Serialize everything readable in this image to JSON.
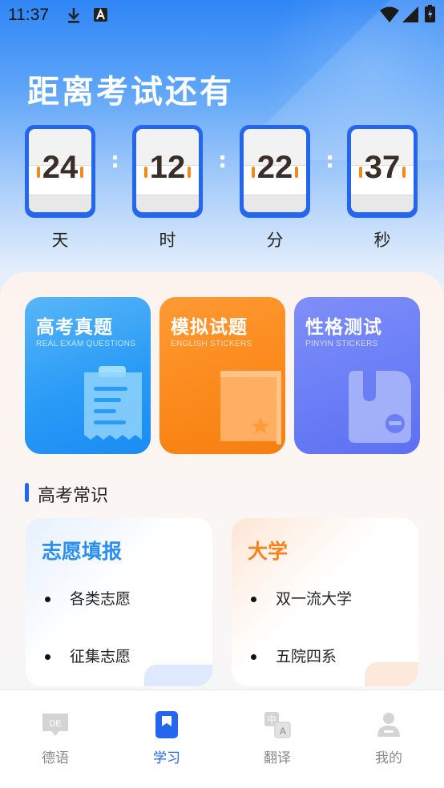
{
  "status_bar": {
    "time": "11:37",
    "icons": [
      "download-icon",
      "a-letter-icon",
      "wifi-icon",
      "signal-icon",
      "battery-icon"
    ]
  },
  "countdown": {
    "title": "距离考试还有",
    "units": [
      {
        "value": "24",
        "label": "天"
      },
      {
        "value": "12",
        "label": "时"
      },
      {
        "value": "22",
        "label": "分"
      },
      {
        "value": "37",
        "label": "秒"
      }
    ],
    "separator": ":"
  },
  "feature_cards": [
    {
      "title": "高考真题",
      "subtitle": "REAL EXAM QUESTIONS",
      "icon": "receipt-icon",
      "color": "#2a9bf6"
    },
    {
      "title": "模拟试题",
      "subtitle": "ENGLISH STICKERS",
      "icon": "book-icon",
      "color": "#fb8a1c"
    },
    {
      "title": "性格测试",
      "subtitle": "PINYIN STICKERS",
      "icon": "folder-icon",
      "color": "#6a7ef6"
    }
  ],
  "section": {
    "title": "高考常识"
  },
  "info_cards": [
    {
      "title": "志愿填报",
      "items": [
        "各类志愿",
        "征集志愿"
      ],
      "color": "#2a8ff0"
    },
    {
      "title": "大学",
      "items": [
        "双一流大学",
        "五院四系"
      ],
      "color": "#f6841e"
    }
  ],
  "tabbar": {
    "tabs": [
      {
        "label": "德语",
        "icon": "de-chat-icon",
        "active": false,
        "icon_text": "DE"
      },
      {
        "label": "学习",
        "icon": "bookmark-icon",
        "active": true
      },
      {
        "label": "翻译",
        "icon": "translate-icon",
        "active": false,
        "icon_text_1": "中",
        "icon_text_2": "A"
      },
      {
        "label": "我的",
        "icon": "user-icon",
        "active": false
      }
    ]
  },
  "colors": {
    "accent": "#2566ef",
    "digit": "#3a2e28",
    "pin": "#f08a1d"
  }
}
